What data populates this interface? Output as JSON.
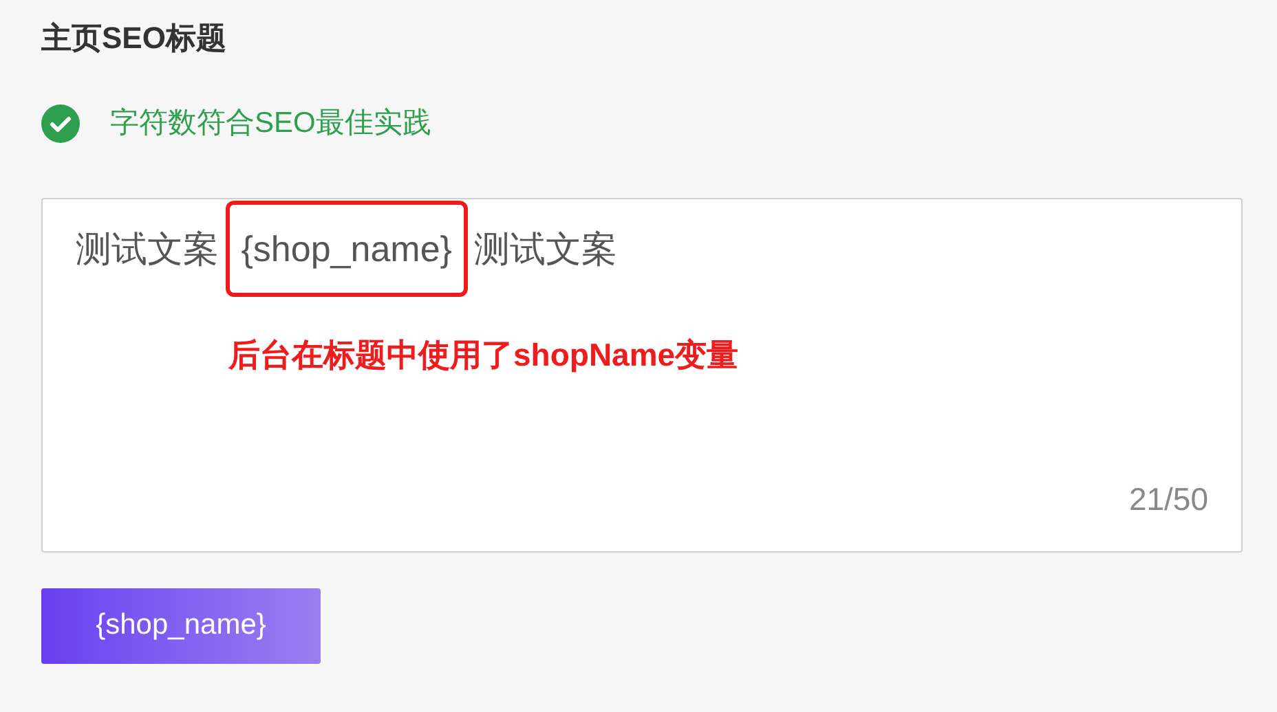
{
  "title": "主页SEO标题",
  "status": {
    "ok": true,
    "text": "字符数符合SEO最佳实践"
  },
  "editor": {
    "value": "测试文案 {shop_name} 测试文案",
    "counter": "21/50"
  },
  "annotation": {
    "text": "后台在标题中使用了shopName变量"
  },
  "variable_button": {
    "label": "{shop_name}"
  }
}
